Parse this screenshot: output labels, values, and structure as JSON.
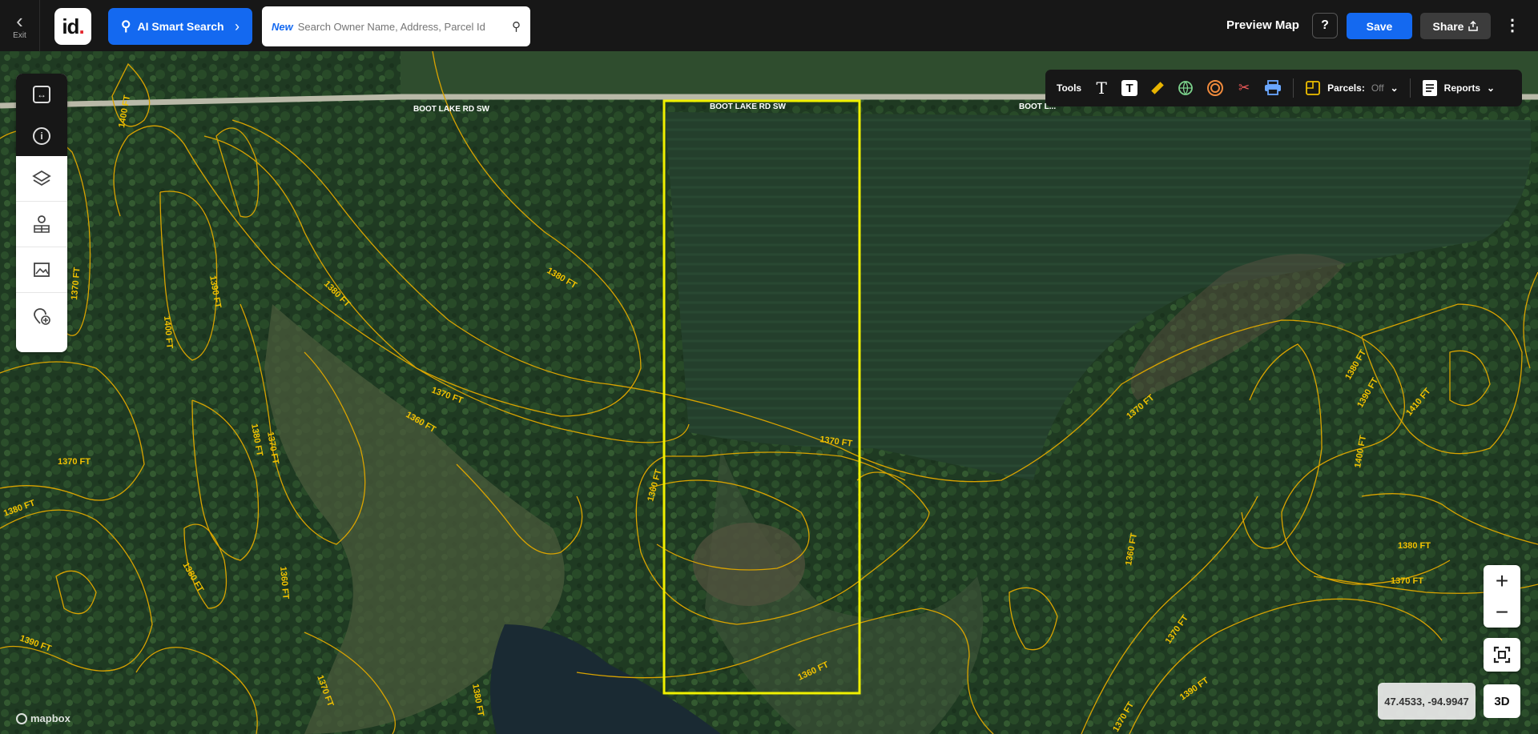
{
  "topbar": {
    "exit_label": "Exit",
    "logo_text": "id",
    "ai_search_label": "AI Smart Search",
    "search_new_tag": "New",
    "search_placeholder": "Search Owner Name, Address, Parcel Id",
    "preview_map_label": "Preview Map",
    "help_label": "?",
    "save_label": "Save",
    "share_label": "Share"
  },
  "tools": {
    "label": "Tools",
    "parcels_label": "Parcels:",
    "parcels_state": "Off",
    "reports_label": "Reports"
  },
  "map": {
    "roads": [
      "BOOT LAKE RD SW",
      "BOOT LAKE RD SW",
      "BOOT L..."
    ],
    "contours": {
      "c1": "1400 FT",
      "c2": "1370 FT",
      "c3": "1400 FT",
      "c4": "1390 FT",
      "c5": "1380 FT",
      "c6": "1380 FT",
      "c7": "1370 FT",
      "c8": "1360 FT",
      "c9": "1380 FT",
      "c10": "1370 FT",
      "c11": "1370 FT",
      "c12": "1380 FT",
      "c13": "1370 FT",
      "c14": "1380 FT",
      "c15": "1360 FT",
      "c16": "1390 FT",
      "c17": "1370 FT",
      "c18": "1380 FT",
      "c19": "1360 FT",
      "c20": "1360 FT",
      "c21": "1360 FT",
      "c22": "1370 FT",
      "c23": "1380 FT",
      "c24": "1390 FT",
      "c25": "1410 FT",
      "c26": "1400 FT",
      "c27": "1380 FT",
      "c28": "1370 FT",
      "c29": "1370 FT",
      "c30": "1390 FT",
      "c31": "1370 FT"
    },
    "attribution": "mapbox"
  },
  "controls": {
    "zoom_in": "+",
    "zoom_out": "−",
    "coordinates": "47.4533, -94.9947",
    "view_3d": "3D"
  },
  "colors": {
    "accent": "#1469f0",
    "parcel_outline": "#f0f000",
    "contour": "#e0a800"
  }
}
